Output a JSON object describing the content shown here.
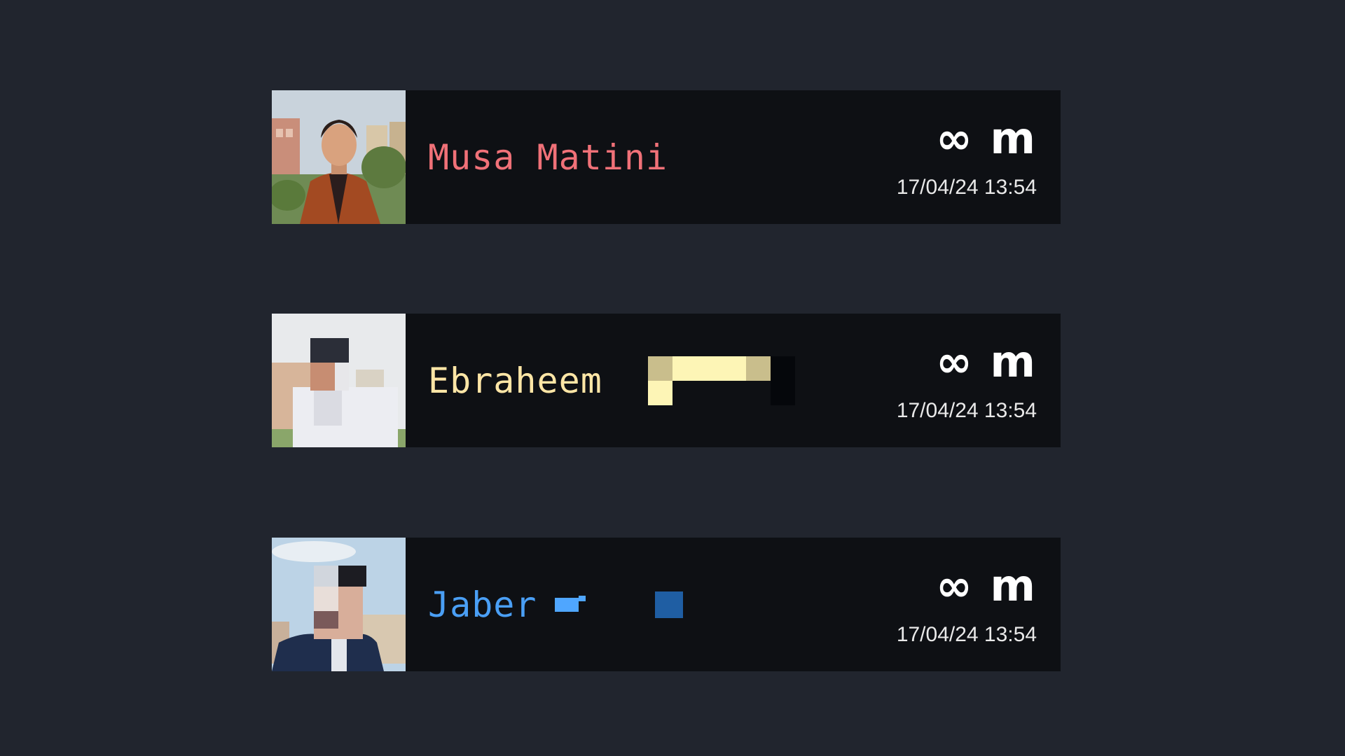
{
  "colors": {
    "background": "#21252e",
    "card": "#0e1014",
    "name_1": "#f07178",
    "name_2": "#ffe6a6",
    "name_3": "#4a9ff5"
  },
  "entries": [
    {
      "name": "Musa Matini",
      "duration": "∞ m",
      "timestamp": "17/04/24 13:54",
      "avatar_icon": "user-photo"
    },
    {
      "name": "Ebraheem",
      "duration": "∞ m",
      "timestamp": "17/04/24 13:54",
      "avatar_icon": "user-photo-pixelated"
    },
    {
      "name": "Jaber",
      "duration": "∞ m",
      "timestamp": "17/04/24 13:54",
      "avatar_icon": "user-photo-pixelated"
    }
  ]
}
